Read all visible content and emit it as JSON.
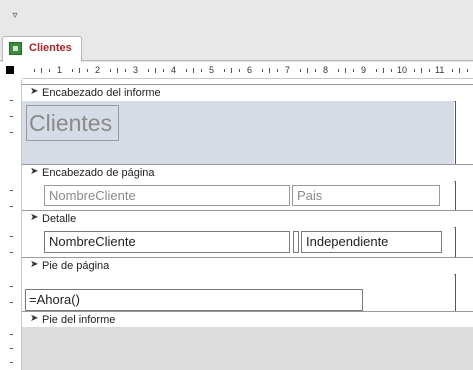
{
  "qat": {
    "customize_icon": "dropdown-arrow-icon"
  },
  "tab": {
    "label": "Clientes",
    "icon": "report-icon"
  },
  "ruler": {
    "numbers": [
      "1",
      "2",
      "3",
      "4",
      "5",
      "6",
      "7",
      "8",
      "9",
      "10",
      "11"
    ]
  },
  "sections": {
    "report_header": {
      "label": "Encabezado del informe",
      "title": "Clientes"
    },
    "page_header": {
      "label": "Encabezado de página",
      "col1": "NombreCliente",
      "col2": "Pais"
    },
    "detail": {
      "label": "Detalle",
      "field1": "NombreCliente",
      "field2": "Independiente"
    },
    "page_footer": {
      "label": "Pie de página",
      "expression": "=Ahora()"
    },
    "report_footer": {
      "label": "Pie del informe"
    }
  },
  "colors": {
    "accent_tab": "#a4262c",
    "report_header_bg": "#d6dce5"
  }
}
